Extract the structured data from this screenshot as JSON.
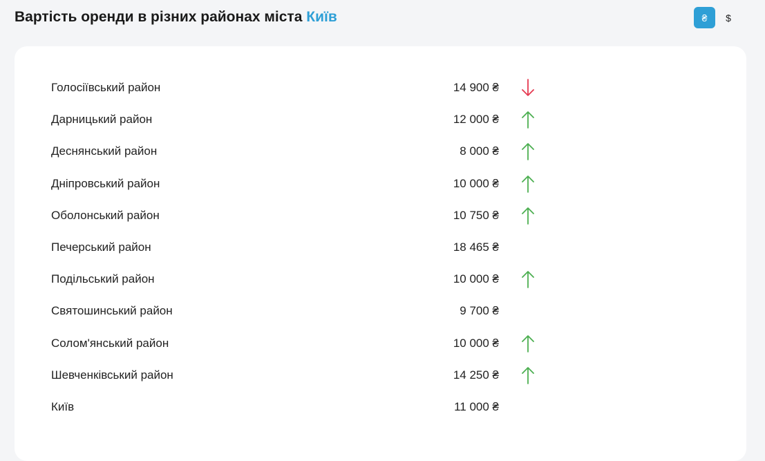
{
  "header": {
    "title_prefix": "Вартість оренди в різних районах міста",
    "title_city": "Київ"
  },
  "currency": {
    "options": [
      {
        "symbol": "₴",
        "active": true
      },
      {
        "symbol": "$",
        "active": false
      }
    ]
  },
  "colors": {
    "accent": "#2e9fd6",
    "trend_up": "#4caf50",
    "trend_down": "#e53950"
  },
  "rows": [
    {
      "district": "Голосіївський район",
      "price": "14 900 ₴",
      "trend": "down"
    },
    {
      "district": "Дарницький район",
      "price": "12 000 ₴",
      "trend": "up"
    },
    {
      "district": "Деснянський район",
      "price": "8 000 ₴",
      "trend": "up"
    },
    {
      "district": "Дніпровський район",
      "price": "10 000 ₴",
      "trend": "up"
    },
    {
      "district": "Оболонський район",
      "price": "10 750 ₴",
      "trend": "up"
    },
    {
      "district": "Печерський район",
      "price": "18 465 ₴",
      "trend": "none"
    },
    {
      "district": "Подільський район",
      "price": "10 000 ₴",
      "trend": "up"
    },
    {
      "district": "Святошинський район",
      "price": "9 700 ₴",
      "trend": "none"
    },
    {
      "district": "Солом'янський район",
      "price": "10 000 ₴",
      "trend": "up"
    },
    {
      "district": "Шевченківський район",
      "price": "14 250 ₴",
      "trend": "up"
    },
    {
      "district": "Київ",
      "price": "11 000 ₴",
      "trend": "none"
    }
  ]
}
